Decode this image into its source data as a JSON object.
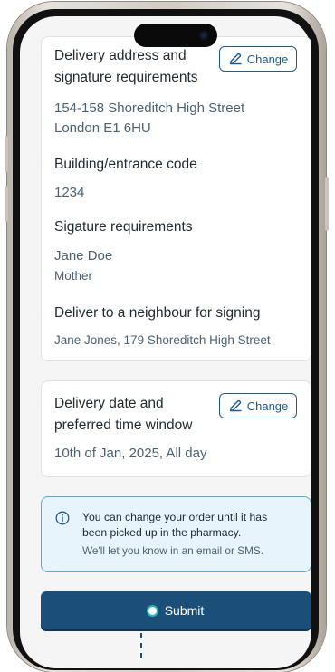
{
  "delivery_card": {
    "title_line1": "Delivery address and",
    "title_line2": "signature requirements",
    "change_label": "Change",
    "address_line1": "154-158 Shoreditch High Street",
    "address_line2": "London E1 6HU",
    "code_label": "Building/entrance code",
    "code_value": "1234",
    "signature_label": "Sigature requirements",
    "signature_name": "Jane Doe",
    "signature_relation": "Mother",
    "neighbour_label": "Deliver to a neighbour for signing",
    "neighbour_value": "Jane Jones, 179 Shoreditch High Street"
  },
  "date_card": {
    "title_line1": "Delivery date and",
    "title_line2": "preferred time window",
    "change_label": "Change",
    "value": "10th of Jan, 2025, All day"
  },
  "info": {
    "main_text": "You can change your order until it has been picked up in the pharmacy.",
    "sub_text": "We'll let you know in an email or SMS."
  },
  "submit": {
    "label": "Submit"
  },
  "icons": {
    "edit": "pencil-icon",
    "info": "info-icon",
    "camera": "camera-icon"
  },
  "colors": {
    "primary": "#1b4f79",
    "link": "#1e5b8f",
    "text": "#212b32",
    "secondary_text": "#4c6272",
    "info_bg": "#e8f4fb",
    "info_border": "#5da8d6",
    "accent_dot": "#2bb3b0"
  }
}
